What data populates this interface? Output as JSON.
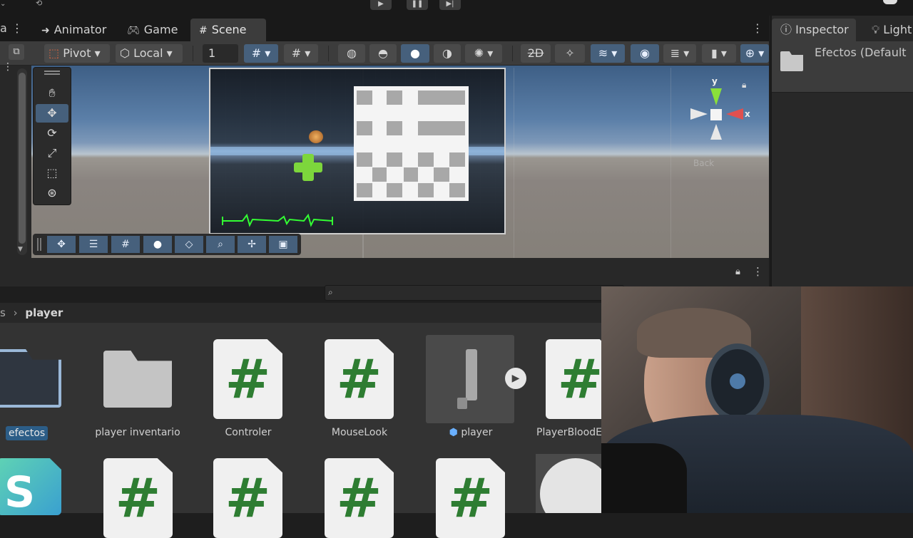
{
  "play_controls": {
    "play_icon": "play-icon",
    "pause_icon": "pause-icon",
    "step_icon": "step-icon"
  },
  "tabs": [
    {
      "label": "Animator",
      "icon": "animator-icon"
    },
    {
      "label": "Game",
      "icon": "gamepad-icon"
    },
    {
      "label": "Scene",
      "icon": "grid-icon",
      "active": true
    }
  ],
  "scene_toolbar": {
    "pivot_label": "Pivot",
    "local_label": "Local",
    "grid_snap_value": "1"
  },
  "inspector": {
    "tab_label": "Inspector",
    "lighting_tab_label": "Light",
    "selected_name": "Efectos (Default"
  },
  "gizmo": {
    "y_label": "y",
    "x_label": "x",
    "view_label": "Back"
  },
  "project": {
    "breadcrumb_prev": "s",
    "breadcrumb_current": "player",
    "items_row1": [
      {
        "name": "efectos",
        "type": "folder-open",
        "selected": true
      },
      {
        "name": "player inventario",
        "type": "folder"
      },
      {
        "name": "Controler",
        "type": "script"
      },
      {
        "name": "MouseLook",
        "type": "script"
      },
      {
        "name": "player",
        "type": "prefab"
      },
      {
        "name": "PlayerBloodEf",
        "type": "script"
      }
    ],
    "items_row2": [
      {
        "name": "",
        "type": "shader"
      },
      {
        "name": "",
        "type": "script"
      },
      {
        "name": "",
        "type": "script"
      },
      {
        "name": "",
        "type": "script"
      },
      {
        "name": "",
        "type": "script"
      },
      {
        "name": "",
        "type": "material"
      }
    ],
    "script_glyph": "#",
    "shader_glyph": "S"
  },
  "colors": {
    "accent_blue": "#46607c",
    "script_green": "#2e7d32",
    "selected_label_bg": "#2c5d87"
  }
}
